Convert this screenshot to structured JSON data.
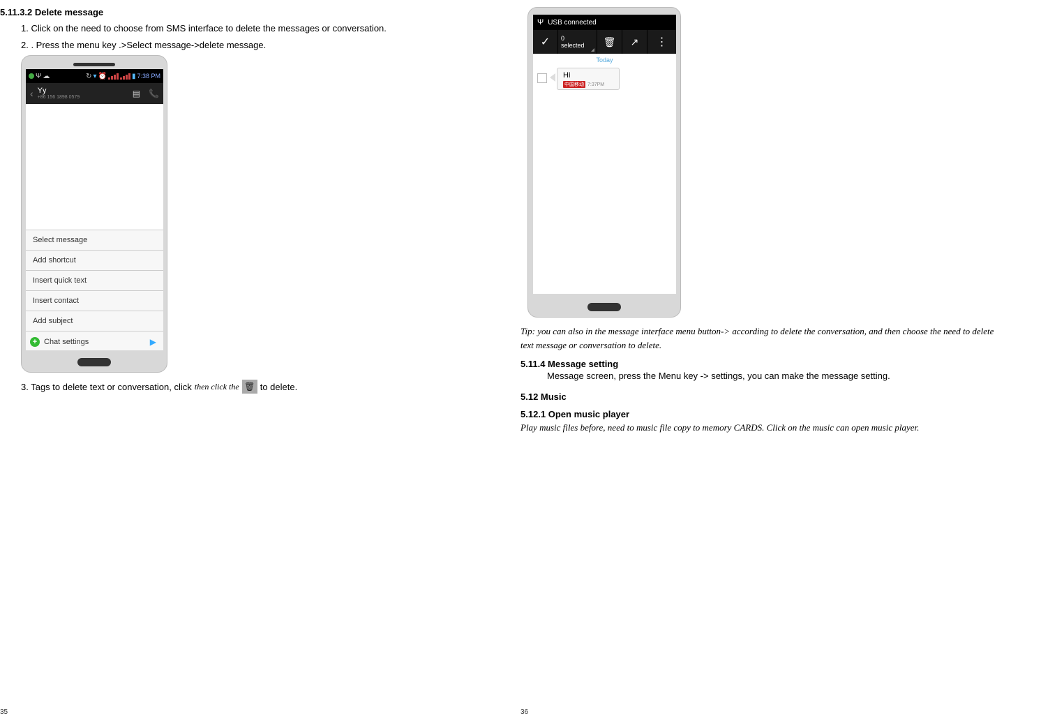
{
  "leftPage": {
    "heading": "5.11.3.2  Delete message",
    "step1": "1. Click on the need to choose from SMS interface to delete the messages or conversation.",
    "step2": "2. . Press the menu key .>Select message->delete message.",
    "step3_p1": "3. Tags to delete text or conversation, click",
    "step3_p2": "then click the",
    "step3_p3": "to delete.",
    "pageNum": "35",
    "phone1": {
      "time": "7:38 PM",
      "contactName": "Yy",
      "contactNumber": "+86 156 1898 0579",
      "menu": {
        "selectMessage": "Select message",
        "addShortcut": "Add shortcut",
        "insertQuick": "Insert quick text",
        "insertContact": "Insert contact",
        "addSubject": "Add subject",
        "chatSettings": "Chat settings"
      }
    }
  },
  "rightPage": {
    "tip": "Tip: you can also in the message interface menu button-> according to delete the conversation, and then choose the need to delete text message or conversation to delete.",
    "h5114": "5.11.4  Message setting",
    "body5114": "Message screen, press the Menu key -> settings, you can make the message setting.",
    "h512": "5.12   Music",
    "h5121": "5.12.1  Open music player",
    "body5121": "Play music files before, need to music file copy to memory CARDS. Click on the music can open music player.",
    "pageNum": "36",
    "phone2": {
      "usbConnected": "USB connected",
      "selCountNum": "0",
      "selCountLabel": "selected",
      "todayLabel": "Today",
      "msgText": "Hi",
      "msgCarrier": "中国移动",
      "msgTime": "7:37PM"
    }
  }
}
